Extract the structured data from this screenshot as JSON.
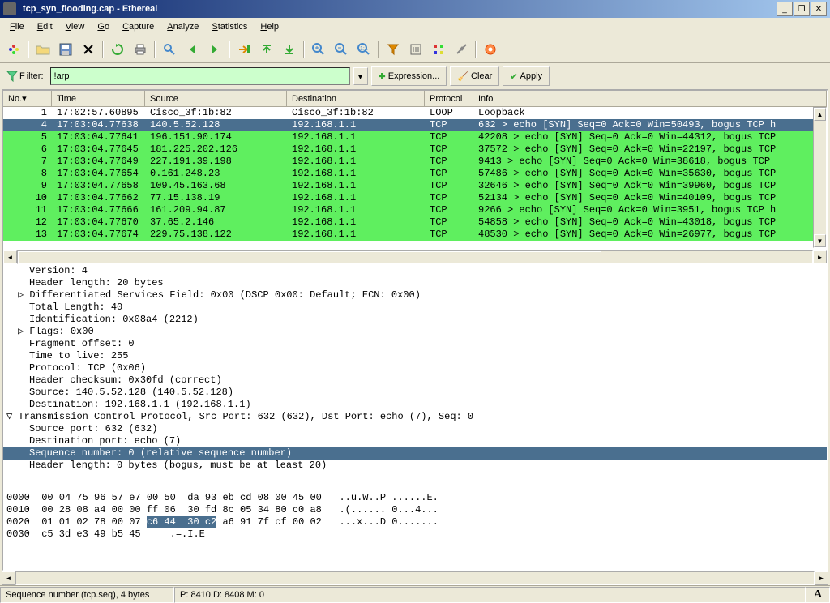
{
  "title": "tcp_syn_flooding.cap - Ethereal",
  "menu": {
    "file": "File",
    "edit": "Edit",
    "view": "View",
    "go": "Go",
    "capture": "Capture",
    "analyze": "Analyze",
    "statistics": "Statistics",
    "help": "Help"
  },
  "filter_label": "Filter:",
  "filter_value": "!arp",
  "btn_expression": "Expression...",
  "btn_clear": "Clear",
  "btn_apply": "Apply",
  "cols": {
    "no": "No. ",
    "time": "Time",
    "source": "Source",
    "destination": "Destination",
    "protocol": "Protocol",
    "info": "Info"
  },
  "col_widths": {
    "no": 60,
    "time": 115,
    "source": 175,
    "destination": 170,
    "protocol": 60,
    "info": 410
  },
  "packets": [
    {
      "no": "1",
      "time": "17:02:57.60895",
      "src": "Cisco_3f:1b:82",
      "dst": "Cisco_3f:1b:82",
      "prot": "LOOP",
      "info": "Loopback",
      "cls": ""
    },
    {
      "no": "4",
      "time": "17:03:04.77638",
      "src": "140.5.52.128",
      "dst": "192.168.1.1",
      "prot": "TCP",
      "info": "632 > echo [SYN] Seq=0 Ack=0 Win=50493, bogus TCP h",
      "cls": "selected"
    },
    {
      "no": "5",
      "time": "17:03:04.77641",
      "src": "196.151.90.174",
      "dst": "192.168.1.1",
      "prot": "TCP",
      "info": "42208 > echo [SYN] Seq=0 Ack=0 Win=44312, bogus TCP",
      "cls": "green"
    },
    {
      "no": "6",
      "time": "17:03:04.77645",
      "src": "181.225.202.126",
      "dst": "192.168.1.1",
      "prot": "TCP",
      "info": "37572 > echo [SYN] Seq=0 Ack=0 Win=22197, bogus TCP",
      "cls": "green"
    },
    {
      "no": "7",
      "time": "17:03:04.77649",
      "src": "227.191.39.198",
      "dst": "192.168.1.1",
      "prot": "TCP",
      "info": "9413 > echo [SYN] Seq=0 Ack=0 Win=38618, bogus TCP",
      "cls": "green"
    },
    {
      "no": "8",
      "time": "17:03:04.77654",
      "src": "0.161.248.23",
      "dst": "192.168.1.1",
      "prot": "TCP",
      "info": "57486 > echo [SYN] Seq=0 Ack=0 Win=35630, bogus TCP",
      "cls": "green"
    },
    {
      "no": "9",
      "time": "17:03:04.77658",
      "src": "109.45.163.68",
      "dst": "192.168.1.1",
      "prot": "TCP",
      "info": "32646 > echo [SYN] Seq=0 Ack=0 Win=39960, bogus TCP",
      "cls": "green"
    },
    {
      "no": "10",
      "time": "17:03:04.77662",
      "src": "77.15.138.19",
      "dst": "192.168.1.1",
      "prot": "TCP",
      "info": "52134 > echo [SYN] Seq=0 Ack=0 Win=40109, bogus TCP",
      "cls": "green"
    },
    {
      "no": "11",
      "time": "17:03:04.77666",
      "src": "161.209.94.87",
      "dst": "192.168.1.1",
      "prot": "TCP",
      "info": "9266 > echo [SYN] Seq=0 Ack=0 Win=3951, bogus TCP h",
      "cls": "green"
    },
    {
      "no": "12",
      "time": "17:03:04.77670",
      "src": "37.65.2.146",
      "dst": "192.168.1.1",
      "prot": "TCP",
      "info": "54858 > echo [SYN] Seq=0 Ack=0 Win=43018, bogus TCP",
      "cls": "green"
    },
    {
      "no": "13",
      "time": "17:03:04.77674",
      "src": "229.75.138.122",
      "dst": "192.168.1.1",
      "prot": "TCP",
      "info": "48530 > echo [SYN] Seq=0 Ack=0 Win=26977, bogus TCP",
      "cls": "green"
    }
  ],
  "tree": [
    {
      "indent": 2,
      "pre": "",
      "txt": "Version: 4"
    },
    {
      "indent": 2,
      "pre": "",
      "txt": "Header length: 20 bytes"
    },
    {
      "indent": 1,
      "pre": "▷ ",
      "txt": "Differentiated Services Field: 0x00 (DSCP 0x00: Default; ECN: 0x00)"
    },
    {
      "indent": 2,
      "pre": "",
      "txt": "Total Length: 40"
    },
    {
      "indent": 2,
      "pre": "",
      "txt": "Identification: 0x08a4 (2212)"
    },
    {
      "indent": 1,
      "pre": "▷ ",
      "txt": "Flags: 0x00"
    },
    {
      "indent": 2,
      "pre": "",
      "txt": "Fragment offset: 0"
    },
    {
      "indent": 2,
      "pre": "",
      "txt": "Time to live: 255"
    },
    {
      "indent": 2,
      "pre": "",
      "txt": "Protocol: TCP (0x06)"
    },
    {
      "indent": 2,
      "pre": "",
      "txt": "Header checksum: 0x30fd (correct)"
    },
    {
      "indent": 2,
      "pre": "",
      "txt": "Source: 140.5.52.128 (140.5.52.128)"
    },
    {
      "indent": 2,
      "pre": "",
      "txt": "Destination: 192.168.1.1 (192.168.1.1)"
    },
    {
      "indent": 0,
      "pre": "▽ ",
      "txt": "Transmission Control Protocol, Src Port: 632 (632), Dst Port: echo (7), Seq: 0"
    },
    {
      "indent": 2,
      "pre": "",
      "txt": "Source port: 632 (632)"
    },
    {
      "indent": 2,
      "pre": "",
      "txt": "Destination port: echo (7)"
    },
    {
      "indent": 2,
      "pre": "",
      "txt": "Sequence number: 0    (relative sequence number)",
      "cls": "selected"
    },
    {
      "indent": 2,
      "pre": "",
      "txt": "Header length: 0 bytes (bogus, must be at least 20)"
    }
  ],
  "hex": [
    {
      "off": "0000",
      "b1": "00 04 75 96 57 e7 00 50",
      "b2": "da 93 eb cd 08 00 45 00",
      "a": "..u.W..P ......E."
    },
    {
      "off": "0010",
      "b1": "00 28 08 a4 00 00 ff 06",
      "b2": "30 fd 8c 05 34 80 c0 a8",
      "a": ".(...... 0...4..."
    },
    {
      "off": "0020",
      "b1": "01 01 02 78 00 07 ",
      "sel": "c6 44  30 c2",
      "b2": " a6 91 7f cf 00 02",
      "a": "...x...D 0......."
    },
    {
      "off": "0030",
      "b1": "c5 3d e3 49 b5 45",
      "b2": "",
      "a": ".=.I.E"
    }
  ],
  "status_left": "Sequence number (tcp.seq), 4 bytes",
  "status_mid": "P: 8410 D: 8408 M: 0",
  "status_right": "A"
}
